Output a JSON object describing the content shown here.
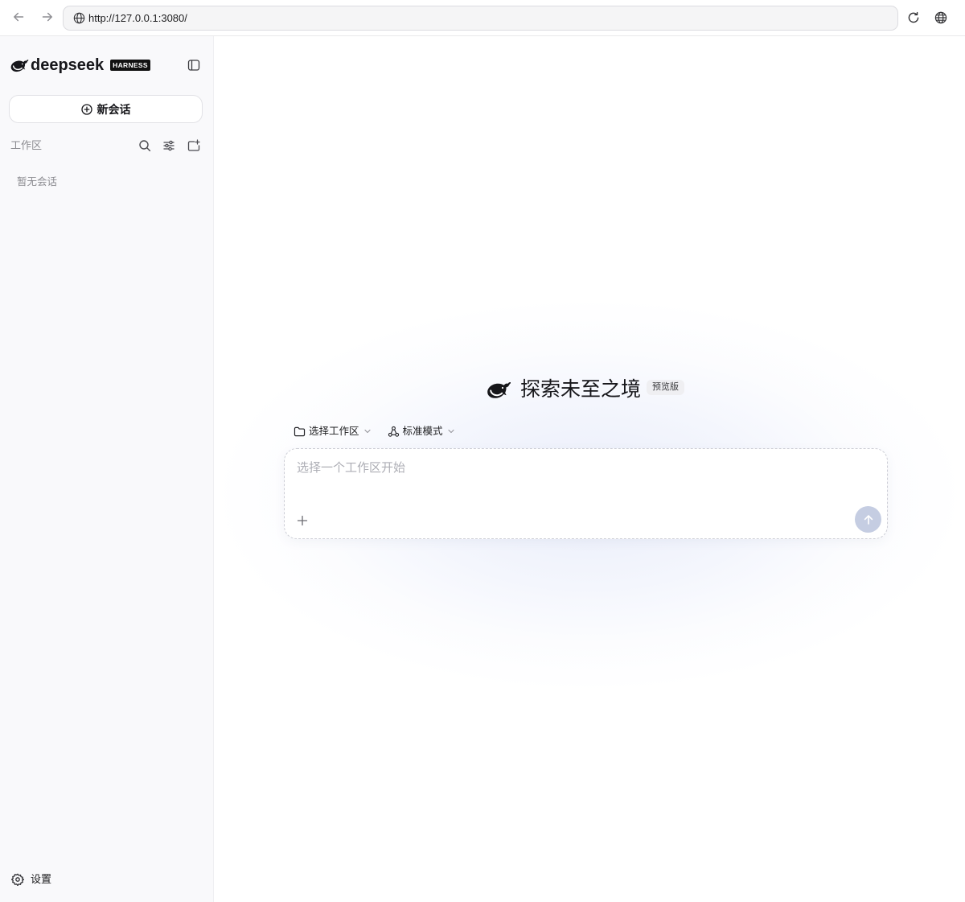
{
  "browser": {
    "url": "http://127.0.0.1:3080/",
    "icons": {
      "back": "arrow-left-icon",
      "forward": "arrow-right-icon",
      "site": "globe-icon",
      "reload": "reload-icon",
      "translate": "globe-icon"
    }
  },
  "sidebar": {
    "brand": {
      "icon": "whale-logo-icon",
      "name": "deepseek",
      "badge": "HARNESS"
    },
    "toggle_icon": "sidebar-toggle-icon",
    "new_chat": {
      "icon": "plus-circle-icon",
      "label": "新会话"
    },
    "workspace": {
      "label": "工作区",
      "actions": [
        {
          "icon": "search-icon"
        },
        {
          "icon": "sliders-icon"
        },
        {
          "icon": "folder-plus-icon"
        }
      ]
    },
    "empty_state": "暂无会话",
    "settings": {
      "icon": "gear-icon",
      "label": "设置"
    }
  },
  "main": {
    "hero": {
      "icon": "whale-logo-icon",
      "title": "探索未至之境",
      "badge": "预览版"
    },
    "workspace_select": {
      "icon": "folder-icon",
      "label": "选择工作区",
      "dropdown_icon": "chevron-down-icon"
    },
    "mode_select": {
      "icon": "mode-icon",
      "label": "标准模式",
      "dropdown_icon": "chevron-down-icon"
    },
    "composer": {
      "placeholder": "选择一个工作区开始",
      "value": "",
      "attach_icon": "plus-icon",
      "send_icon": "arrow-up-icon"
    }
  },
  "colors": {
    "sidebar_bg": "#f9f9fb",
    "text_primary": "#1d1d1f",
    "text_muted": "#8b8b90",
    "brand_badge_bg": "#111111",
    "preview_badge_bg": "#efeff2",
    "send_button": "#c5cde2",
    "glow": "#e2e7f8"
  }
}
